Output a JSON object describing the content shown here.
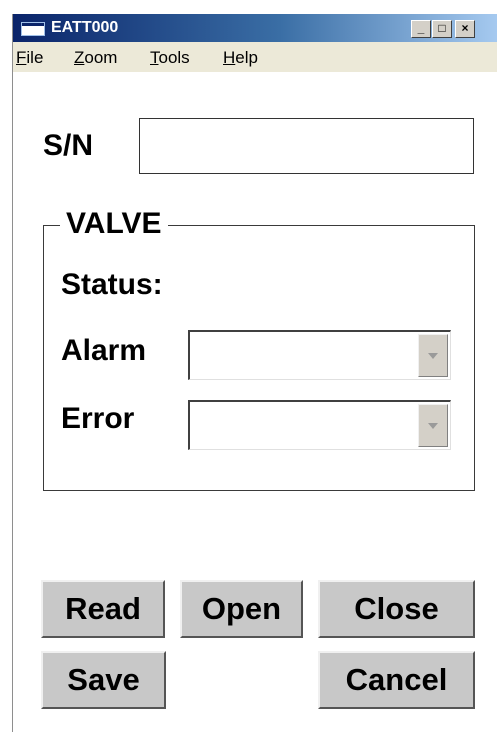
{
  "window": {
    "title": "EATT000",
    "controls": {
      "minimize": "_",
      "maximize": "□",
      "close": "×"
    }
  },
  "menu": {
    "items": [
      {
        "accel": "F",
        "rest": "ile"
      },
      {
        "accel": "Z",
        "rest": "oom"
      },
      {
        "accel": "T",
        "rest": "ools"
      },
      {
        "accel": "H",
        "rest": "elp"
      }
    ]
  },
  "form": {
    "sn_label": "S/N",
    "sn_value": "",
    "valve_group_title": "VALVE",
    "status_label": "Status:",
    "alarm_label": "Alarm",
    "alarm_value": "",
    "error_label": "Error",
    "error_value": ""
  },
  "buttons": {
    "read": "Read",
    "open": "Open",
    "close": "Close",
    "save": "Save",
    "cancel": "Cancel"
  },
  "colors": {
    "title_gradient_start": "#0a246a",
    "title_gradient_end": "#a6caf0",
    "button_face": "#c8c8c8",
    "menubar": "#ece9d8"
  }
}
